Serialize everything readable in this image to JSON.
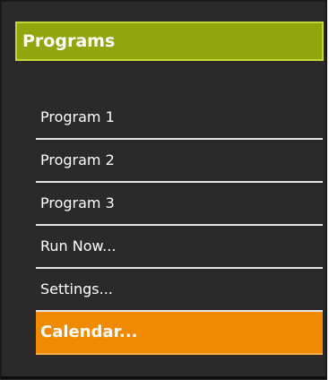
{
  "panel": {
    "title": "Programs"
  },
  "menu": {
    "items": [
      {
        "label": "Program 1"
      },
      {
        "label": "Program 2"
      },
      {
        "label": "Program 3"
      },
      {
        "label": "Run Now..."
      },
      {
        "label": "Settings..."
      },
      {
        "label": "Calendar...",
        "selected": true
      }
    ]
  },
  "colors": {
    "panel_background": "#2b2a28",
    "header_background": "#91a50c",
    "selected_item_background": "#f08a00",
    "text": "#ffffff"
  }
}
